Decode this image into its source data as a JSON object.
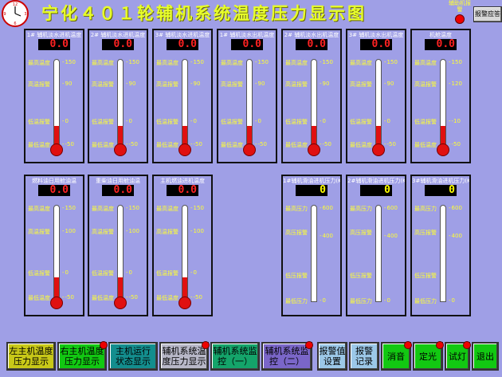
{
  "header": {
    "title": "宁化４０１轮辅机系统温度压力显示图",
    "alarm_label": "辅助机报警",
    "ack_button": "报警应答"
  },
  "panels": [
    {
      "title": "1# 辅机淡水进机温度",
      "value": "0.0",
      "high": "最高温度",
      "alarm_hi": "高温报警",
      "alarm_lo": "低温报警",
      "low": "最低温度",
      "ticks": [
        "150",
        "90",
        "0",
        "-50"
      ],
      "fill_fraction": 0.22
    },
    {
      "title": "2# 辅机淡水进机温度",
      "value": "0.0",
      "high": "最高温度",
      "alarm_hi": "高温报警",
      "alarm_lo": "低温报警",
      "low": "最低温度",
      "ticks": [
        "150",
        "90",
        "0",
        "-50"
      ],
      "fill_fraction": 0.22
    },
    {
      "title": "3# 辅机淡水进机温度",
      "value": "0.0",
      "high": "最高温度",
      "alarm_hi": "高温报警",
      "alarm_lo": "低温报警",
      "low": "最低温度",
      "ticks": [
        "150",
        "90",
        "0",
        "-50"
      ],
      "fill_fraction": 0.22
    },
    {
      "title": "1# 辅机淡水出机温度",
      "value": "0.0",
      "high": "最高温度",
      "alarm_hi": "高温报警",
      "alarm_lo": "低温报警",
      "low": "最低温度",
      "ticks": [
        "150",
        "90",
        "0",
        "-50"
      ],
      "fill_fraction": 0.22
    },
    {
      "title": "2# 辅机淡水出机温度",
      "value": "0.0",
      "high": "最高温度",
      "alarm_hi": "高温报警",
      "alarm_lo": "低温报警",
      "low": "最低温度",
      "ticks": [
        "150",
        "90",
        "0",
        "-50"
      ],
      "fill_fraction": 0.22
    },
    {
      "title": "3# 辅机淡水出机温度",
      "value": "0.0",
      "high": "最高温度",
      "alarm_hi": "高温报警",
      "alarm_lo": "低温报警",
      "low": "最低温度",
      "ticks": [
        "150",
        "90",
        "0",
        "-50"
      ],
      "fill_fraction": 0.22
    },
    {
      "title": "机舱温度",
      "value": "0.0",
      "high": "最高温度",
      "alarm_hi": "高温报警",
      "alarm_lo": "低温报警",
      "low": "最低温度",
      "ticks": [
        "150",
        "120",
        "-10",
        "-50"
      ],
      "fill_fraction": 0.22
    }
  ],
  "panels2": [
    {
      "title": "燃料油日用舱油温",
      "value": "0.0",
      "high": "最高温度",
      "alarm_hi": "高温报警",
      "alarm_lo": "低温报警",
      "low": "最低温度",
      "ticks": [
        "150",
        "100",
        "0",
        "-50"
      ],
      "fill_fraction": 0.22
    },
    {
      "title": "重柴油日用舱油温",
      "value": "0.0",
      "high": "最高温度",
      "alarm_hi": "高温报警",
      "alarm_lo": "低温报警",
      "low": "最低温度",
      "ticks": [
        "150",
        "100",
        "0",
        "-50"
      ],
      "fill_fraction": 0.22
    },
    {
      "title": "主机燃油进机温度",
      "value": "0.0",
      "high": "最高温度",
      "alarm_hi": "高温报警",
      "alarm_lo": "低温报警",
      "low": "最低温度",
      "ticks": [
        "150",
        "100",
        "0",
        "-50"
      ],
      "fill_fraction": 0.22
    }
  ],
  "panels3": [
    {
      "title": "1#辅机滑油进机压力(KPa)",
      "value": "0",
      "high": "最高压力",
      "alarm_hi": "高压报警",
      "alarm_lo": "低压报警",
      "low": "最低压力",
      "ticks": [
        "600",
        "400",
        "0"
      ],
      "fill_fraction": 0.0
    },
    {
      "title": "2#辅机滑油进机压力(KPa)",
      "value": "0",
      "high": "最高压力",
      "alarm_hi": "高压报警",
      "alarm_lo": "低压报警",
      "low": "最低压力",
      "ticks": [
        "600",
        "400",
        "0"
      ],
      "fill_fraction": 0.0
    },
    {
      "title": "3#辅机滑油进机压力(KPa)",
      "value": "0",
      "high": "最高压力",
      "alarm_hi": "高压报警",
      "alarm_lo": "低压报警",
      "low": "最低压力",
      "ticks": [
        "600",
        "400",
        "0"
      ],
      "fill_fraction": 0.0
    }
  ],
  "toolbar": [
    {
      "label": "左主机温度\n压力显示",
      "color": "#c8c818"
    },
    {
      "label": "右主机温度\n压力显示",
      "color": "#12c812"
    },
    {
      "label": "主机运行\n状态显示",
      "color": "#138e8e"
    },
    {
      "label": "辅机系统温\n度压力显示",
      "color": "#b8b8c8"
    },
    {
      "label": "辅机系统监\n控（一）",
      "color": "#14a46a"
    },
    {
      "label": "辅机系统监\n控（二）",
      "color": "#7a66c8"
    },
    {
      "label": "报警值\n设置",
      "color": "#9cc8e8"
    },
    {
      "label": "报警\n记录",
      "color": "#9cc8e8"
    },
    {
      "label": "消音",
      "color": "#12c812"
    },
    {
      "label": "定光",
      "color": "#12c812"
    },
    {
      "label": "试灯",
      "color": "#12c812"
    },
    {
      "label": "退出",
      "color": "#12c812"
    }
  ]
}
